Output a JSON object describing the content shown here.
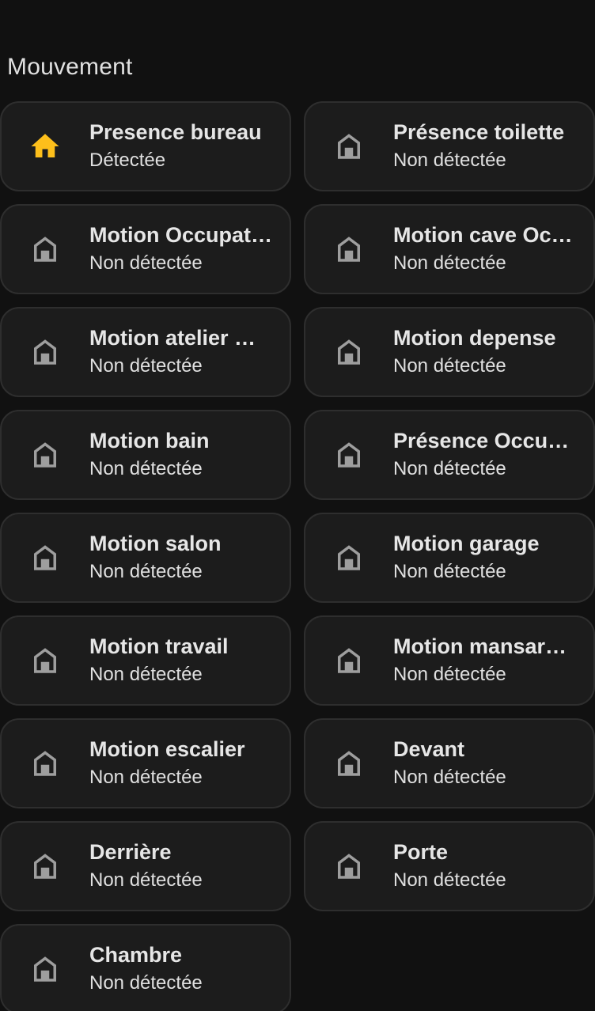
{
  "section": {
    "title": "Mouvement"
  },
  "colors": {
    "active_icon": "#fdbf1b",
    "inactive_icon": "#9e9e9e"
  },
  "tiles": [
    {
      "name": "Presence bureau",
      "state": "Détectée",
      "icon": "home-icon",
      "active": true
    },
    {
      "name": "Présence toilette",
      "state": "Non détectée",
      "icon": "home-outline-icon",
      "active": false
    },
    {
      "name": "Motion Occupati…",
      "state": "Non détectée",
      "icon": "home-outline-icon",
      "active": false
    },
    {
      "name": "Motion cave Occ…",
      "state": "Non détectée",
      "icon": "home-outline-icon",
      "active": false
    },
    {
      "name": "Motion atelier O…",
      "state": "Non détectée",
      "icon": "home-outline-icon",
      "active": false
    },
    {
      "name": "Motion depense",
      "state": "Non détectée",
      "icon": "home-outline-icon",
      "active": false
    },
    {
      "name": "Motion bain",
      "state": "Non détectée",
      "icon": "home-outline-icon",
      "active": false
    },
    {
      "name": "Présence Occup…",
      "state": "Non détectée",
      "icon": "home-outline-icon",
      "active": false
    },
    {
      "name": "Motion salon",
      "state": "Non détectée",
      "icon": "home-outline-icon",
      "active": false
    },
    {
      "name": "Motion garage",
      "state": "Non détectée",
      "icon": "home-outline-icon",
      "active": false
    },
    {
      "name": "Motion travail",
      "state": "Non détectée",
      "icon": "home-outline-icon",
      "active": false
    },
    {
      "name": "Motion mansard…",
      "state": "Non détectée",
      "icon": "home-outline-icon",
      "active": false
    },
    {
      "name": "Motion escalier",
      "state": "Non détectée",
      "icon": "home-outline-icon",
      "active": false
    },
    {
      "name": "Devant",
      "state": "Non détectée",
      "icon": "home-outline-icon",
      "active": false
    },
    {
      "name": "Derrière",
      "state": "Non détectée",
      "icon": "home-outline-icon",
      "active": false
    },
    {
      "name": "Porte",
      "state": "Non détectée",
      "icon": "home-outline-icon",
      "active": false
    },
    {
      "name": "Chambre",
      "state": "Non détectée",
      "icon": "home-outline-icon",
      "active": false
    }
  ]
}
